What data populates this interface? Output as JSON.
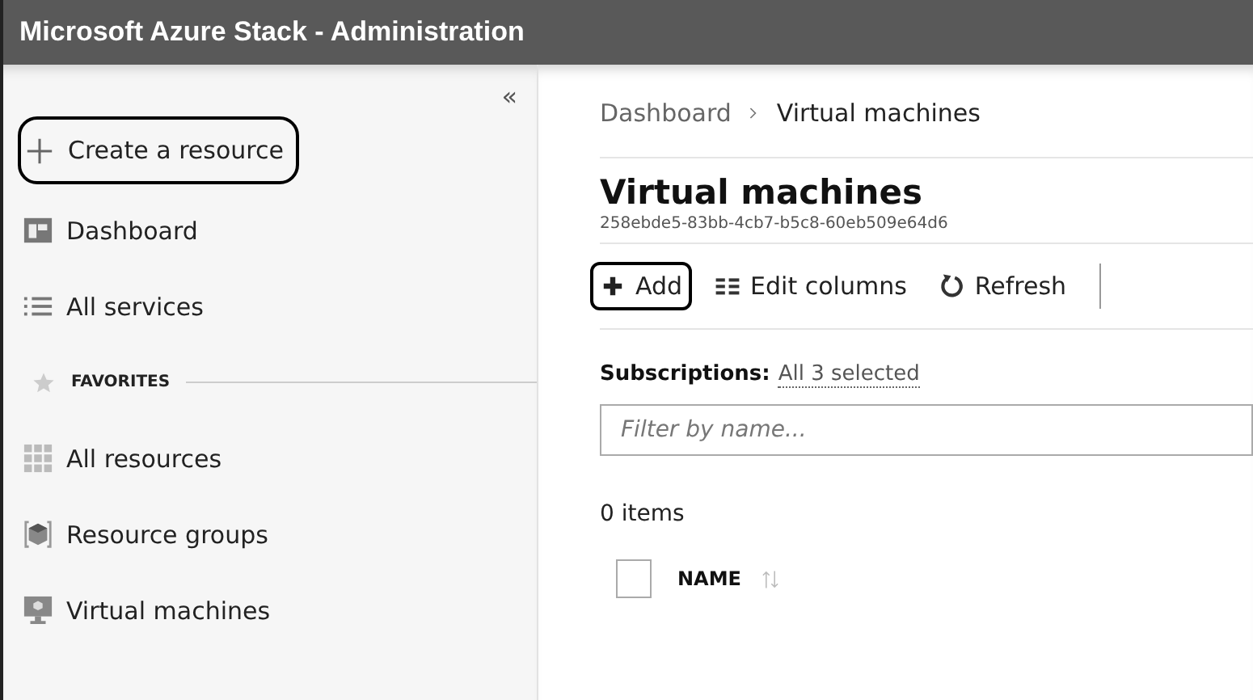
{
  "window": {
    "title": "Microsoft Azure Stack - Administration"
  },
  "sidebar": {
    "collapse": "«",
    "items": [
      {
        "label": "Create a resource",
        "highlighted": true
      },
      {
        "label": "Dashboard",
        "highlighted": false
      },
      {
        "label": "All services",
        "highlighted": false
      }
    ],
    "favorites_heading": "FAVORITES",
    "favorites": [
      {
        "label": "All resources"
      },
      {
        "label": "Resource groups"
      },
      {
        "label": "Virtual machines"
      }
    ]
  },
  "breadcrumb": [
    {
      "label": "Dashboard"
    },
    {
      "label": "Virtual machines"
    }
  ],
  "page": {
    "title": "Virtual machines",
    "subtitle": "258ebde5-83bb-4cb7-b5c8-60eb509e64d6"
  },
  "toolbar": [
    {
      "label": "Add",
      "highlighted": true
    },
    {
      "label": "Edit columns",
      "highlighted": false
    },
    {
      "label": "Refresh",
      "highlighted": false
    }
  ],
  "subscriptions": {
    "label": "Subscriptions:",
    "value": "All 3 selected"
  },
  "filter": {
    "placeholder": "Filter by name..."
  },
  "count": "0 items",
  "table": {
    "columns": [
      {
        "label": "NAME"
      }
    ],
    "select_all_checked": false
  }
}
